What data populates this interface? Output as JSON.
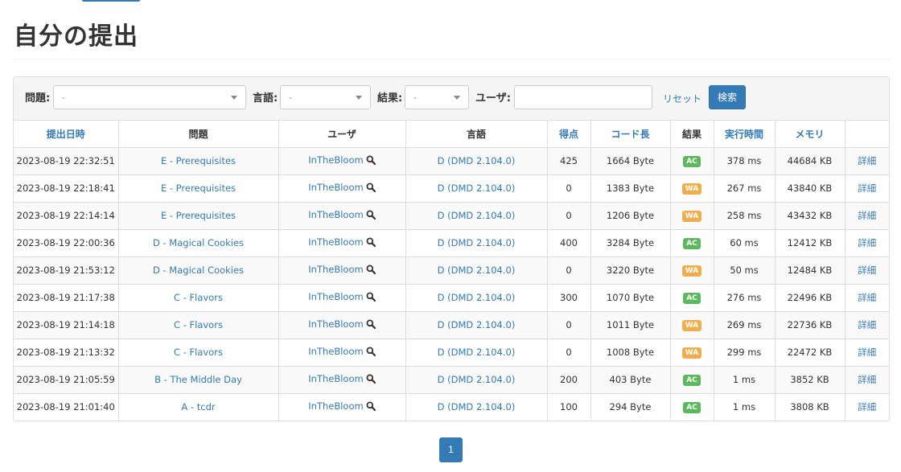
{
  "page": {
    "title": "自分の提出"
  },
  "filters": {
    "task_label": "問題:",
    "task_value": "-",
    "language_label": "言語:",
    "language_value": "-",
    "status_label": "結果:",
    "status_value": "-",
    "user_label": "ユーザ:",
    "user_value": "",
    "reset_label": "リセット",
    "search_label": "検索"
  },
  "table": {
    "headers": {
      "date": "提出日時",
      "task": "問題",
      "user": "ユーザ",
      "language": "言語",
      "score": "得点",
      "code_length": "コード長",
      "status": "結果",
      "exec_time": "実行時間",
      "memory": "メモリ"
    },
    "rows": [
      {
        "date": "2023-08-19 22:32:51",
        "task": "E - Prerequisites",
        "user": "InTheBloom",
        "language": "D (DMD 2.104.0)",
        "score": "425",
        "code_length": "1664 Byte",
        "status": "AC",
        "exec_time": "378 ms",
        "memory": "44684 KB",
        "detail": "詳細"
      },
      {
        "date": "2023-08-19 22:18:41",
        "task": "E - Prerequisites",
        "user": "InTheBloom",
        "language": "D (DMD 2.104.0)",
        "score": "0",
        "code_length": "1383 Byte",
        "status": "WA",
        "exec_time": "267 ms",
        "memory": "43840 KB",
        "detail": "詳細"
      },
      {
        "date": "2023-08-19 22:14:14",
        "task": "E - Prerequisites",
        "user": "InTheBloom",
        "language": "D (DMD 2.104.0)",
        "score": "0",
        "code_length": "1206 Byte",
        "status": "WA",
        "exec_time": "258 ms",
        "memory": "43432 KB",
        "detail": "詳細"
      },
      {
        "date": "2023-08-19 22:00:36",
        "task": "D - Magical Cookies",
        "user": "InTheBloom",
        "language": "D (DMD 2.104.0)",
        "score": "400",
        "code_length": "3284 Byte",
        "status": "AC",
        "exec_time": "60 ms",
        "memory": "12412 KB",
        "detail": "詳細"
      },
      {
        "date": "2023-08-19 21:53:12",
        "task": "D - Magical Cookies",
        "user": "InTheBloom",
        "language": "D (DMD 2.104.0)",
        "score": "0",
        "code_length": "3220 Byte",
        "status": "WA",
        "exec_time": "50 ms",
        "memory": "12484 KB",
        "detail": "詳細"
      },
      {
        "date": "2023-08-19 21:17:38",
        "task": "C - Flavors",
        "user": "InTheBloom",
        "language": "D (DMD 2.104.0)",
        "score": "300",
        "code_length": "1070 Byte",
        "status": "AC",
        "exec_time": "276 ms",
        "memory": "22496 KB",
        "detail": "詳細"
      },
      {
        "date": "2023-08-19 21:14:18",
        "task": "C - Flavors",
        "user": "InTheBloom",
        "language": "D (DMD 2.104.0)",
        "score": "0",
        "code_length": "1011 Byte",
        "status": "WA",
        "exec_time": "269 ms",
        "memory": "22736 KB",
        "detail": "詳細"
      },
      {
        "date": "2023-08-19 21:13:32",
        "task": "C - Flavors",
        "user": "InTheBloom",
        "language": "D (DMD 2.104.0)",
        "score": "0",
        "code_length": "1008 Byte",
        "status": "WA",
        "exec_time": "299 ms",
        "memory": "22472 KB",
        "detail": "詳細"
      },
      {
        "date": "2023-08-19 21:05:59",
        "task": "B - The Middle Day",
        "user": "InTheBloom",
        "language": "D (DMD 2.104.0)",
        "score": "200",
        "code_length": "403 Byte",
        "status": "AC",
        "exec_time": "1 ms",
        "memory": "3852 KB",
        "detail": "詳細"
      },
      {
        "date": "2023-08-19 21:01:40",
        "task": "A - tcdr",
        "user": "InTheBloom",
        "language": "D (DMD 2.104.0)",
        "score": "100",
        "code_length": "294 Byte",
        "status": "AC",
        "exec_time": "1 ms",
        "memory": "3808 KB",
        "detail": "詳細"
      }
    ]
  },
  "status_colors": {
    "AC": "#5cb85c",
    "WA": "#f0ad4e"
  },
  "accent_color": "#337ab7",
  "pagination": {
    "pages": [
      "1"
    ],
    "current": "1"
  }
}
